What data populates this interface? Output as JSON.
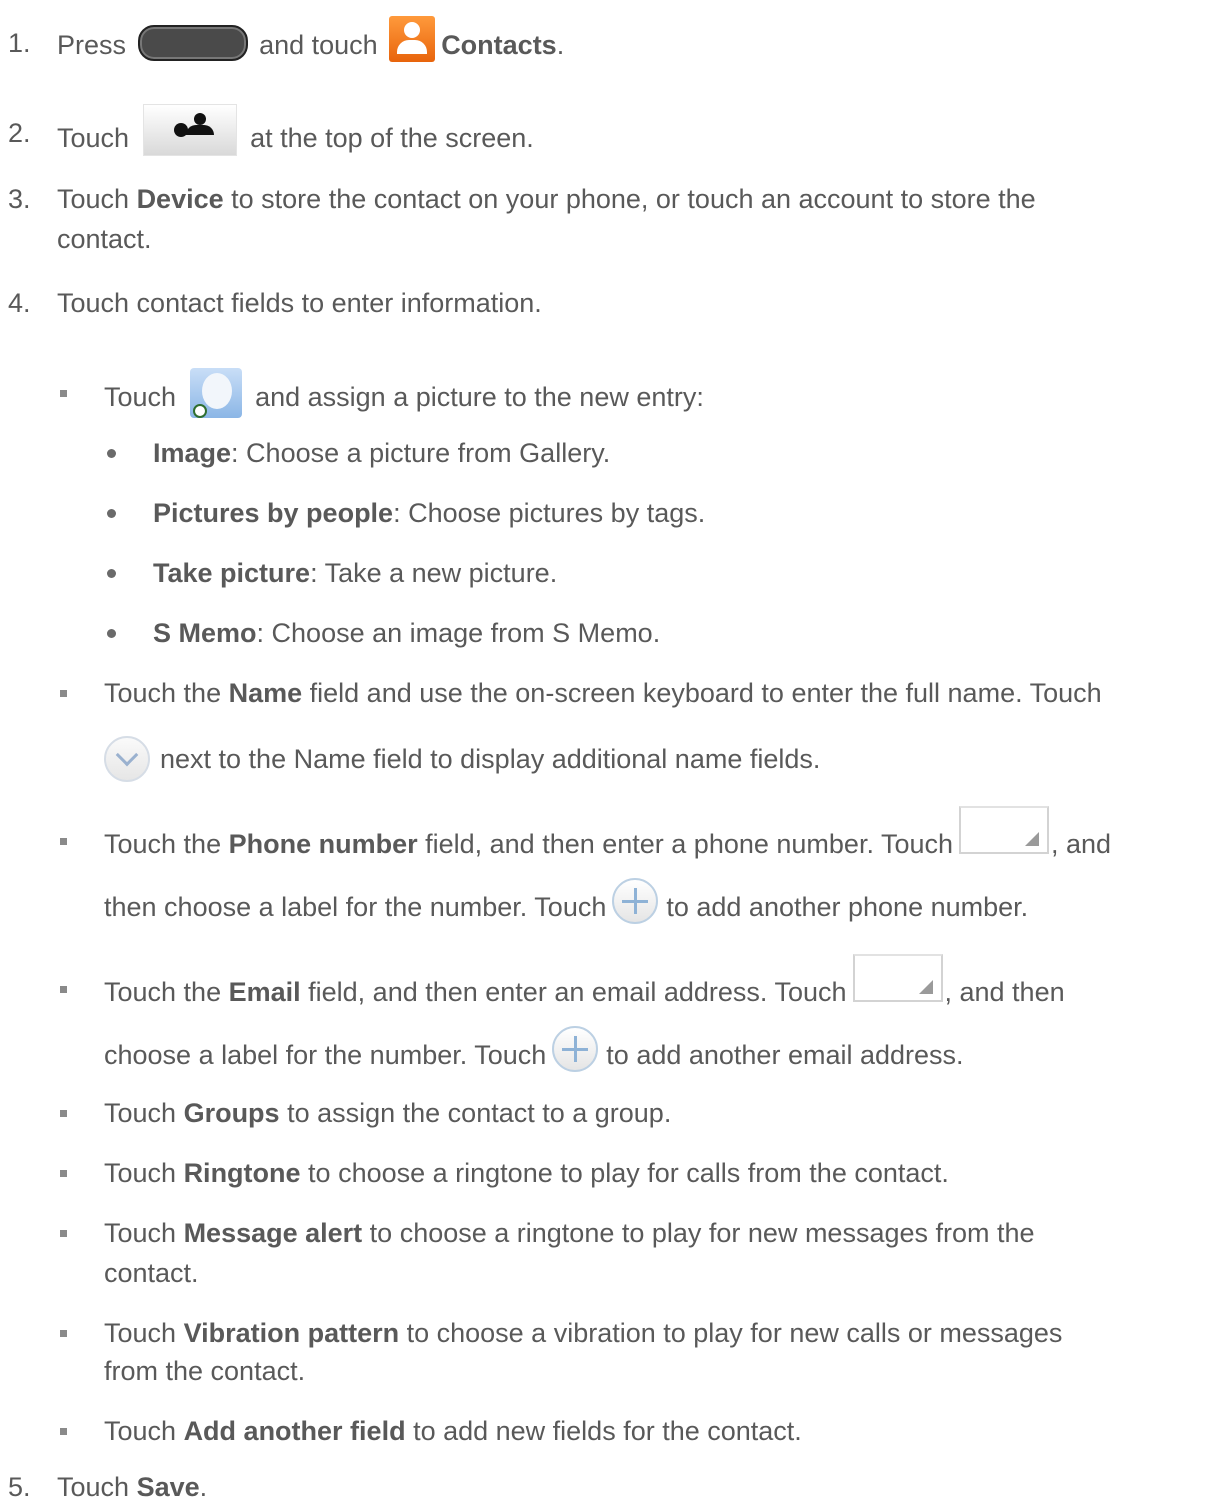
{
  "steps": {
    "s1": {
      "num": "1.",
      "pre": "Press",
      "mid": "and touch",
      "bold": "Contacts",
      "post": "."
    },
    "s2": {
      "num": "2.",
      "pre": "Touch",
      "post": "at the top of the screen."
    },
    "s3": {
      "num": "3.",
      "pre": "Touch ",
      "bold": "Device",
      "post_line1": " to store the contact on your phone, or touch an account to store the",
      "line2": "contact."
    },
    "s4": {
      "num": "4.",
      "text": "Touch contact fields to enter information."
    },
    "s5": {
      "num": "5.",
      "pre": "Touch ",
      "bold": "Save",
      "post": "."
    }
  },
  "bullets": {
    "picture": {
      "pre": "Touch",
      "post": "and assign a picture to the new entry:"
    },
    "picture_options": [
      {
        "bold": "Image",
        "text": ": Choose a picture from Gallery."
      },
      {
        "bold": "Pictures by people",
        "text": ": Choose pictures by tags."
      },
      {
        "bold": "Take picture",
        "text": ": Take a new picture."
      },
      {
        "bold": "S Memo",
        "text": ": Choose an image from S Memo."
      }
    ],
    "name": {
      "pre": "Touch the ",
      "bold": "Name",
      "post": " field and use the on-screen keyboard to enter the full name. Touch",
      "line2": "next to the Name field to display additional name fields."
    },
    "phone": {
      "pre": "Touch the ",
      "bold": "Phone number",
      "post": " field, and then enter a phone number. Touch",
      "post2": ", and",
      "line2a": "then choose a label for the number. Touch",
      "line2b": "to add another phone number."
    },
    "email": {
      "pre": "Touch the ",
      "bold": "Email",
      "post": " field, and then enter an email address. Touch",
      "post2": ", and then",
      "line2a": "choose a label for the number. Touch",
      "line2b": "to add another email address."
    },
    "groups": {
      "pre": "Touch ",
      "bold": "Groups",
      "post": " to assign the contact to a group."
    },
    "ringtone": {
      "pre": "Touch ",
      "bold": "Ringtone",
      "post": " to choose a ringtone to play for calls from the contact."
    },
    "message": {
      "pre": "Touch ",
      "bold": "Message alert",
      "post": " to choose a ringtone to play for new messages from the",
      "line2": "contact."
    },
    "vibration": {
      "pre": "Touch ",
      "bold": "Vibration pattern",
      "post": " to choose a vibration to play for new calls or messages",
      "line2": "from the contact."
    },
    "another": {
      "pre": "Touch ",
      "bold": "Add another field",
      "post": " to add new fields for the contact."
    }
  },
  "icons": {
    "home_button": "home-key-icon",
    "contacts_app": "contacts-app-icon",
    "add_contact": "add-contact-icon",
    "picture": "contact-picture-icon",
    "expand": "chevron-down-icon",
    "label_dropdown": "dropdown-icon",
    "add_field": "plus-circle-icon"
  }
}
